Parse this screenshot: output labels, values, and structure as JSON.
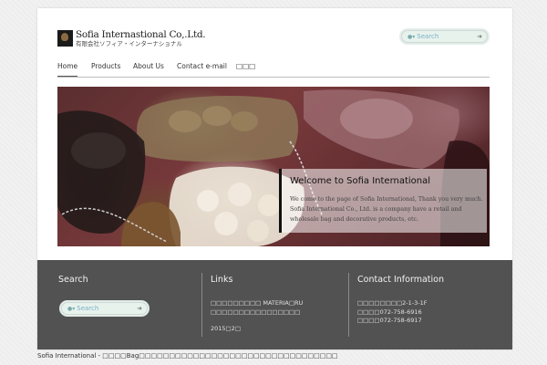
{
  "header": {
    "logo_en": "Sofia Internastional Co,.Ltd.",
    "logo_ja": "有限会社ソフィア・インターナショナル",
    "search_placeholder": "Search",
    "search_go": "➜"
  },
  "nav": {
    "items": [
      {
        "label": "Home",
        "active": true
      },
      {
        "label": "Products",
        "active": false
      },
      {
        "label": "About Us",
        "active": false
      },
      {
        "label": "Contact e-mail",
        "active": false
      },
      {
        "label": "□□□",
        "active": false
      }
    ]
  },
  "hero": {
    "title": "Welcome to Sofia International",
    "text": "We come to the page of Sofia International, Thank you very much. Sofia International Co., Ltd. is a company have a retail and wholesale bag and decorative products, etc."
  },
  "footer": {
    "search": {
      "title": "Search",
      "placeholder": "Search",
      "go": "➜"
    },
    "links": {
      "title": "Links",
      "lines": [
        "□□□□□□□□□ MATERIA□RU",
        "□□□□□□□□□□□□□□□□"
      ],
      "date": "2015□2□"
    },
    "contact": {
      "title": "Contact Information",
      "lines": [
        "□□□□□□□□2-1-3-1F",
        "□□□□072-758-6916",
        "□□□□072-758-6917"
      ]
    }
  },
  "bottom": {
    "text": "Sofia International - □□□□Bag□□□□□□□□□□□□□□□□□□□□□□□□□□□□□□□□□"
  },
  "colors": {
    "footer_bg": "#525252",
    "page_bg": "#f1f1f1",
    "search_text": "#78b2c3"
  }
}
